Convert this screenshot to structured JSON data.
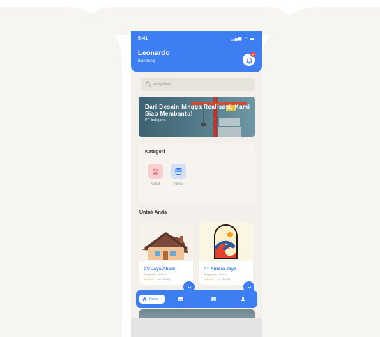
{
  "status": {
    "time": "9:41",
    "icons": "▂▄▆ ◠ ▬"
  },
  "header": {
    "name": "Leonardo",
    "city": "Bandung",
    "notif_count": "9+"
  },
  "search": {
    "placeholder": "cari jobmu"
  },
  "banner": {
    "title": "Dari Desain hingga Realisasi, Kami Siap Membantu!",
    "subtitle": "PT Indojaya"
  },
  "categories": {
    "title": "Kategori",
    "items": [
      {
        "label": "Rumah",
        "icon": "house-icon",
        "color": "#f8cfd0"
      },
      {
        "label": "Interior",
        "icon": "interior-icon",
        "color": "#d5dff5"
      }
    ]
  },
  "section": {
    "title": "Untuk Anda"
  },
  "cards": [
    {
      "name": "CV Jaya Abadi",
      "category": "Bangunan / Interior",
      "stars": "★★★★☆",
      "rating": "4.8 (2.440)"
    },
    {
      "name": "PT Amora Jaya",
      "category": "Bangunan / Interior",
      "stars": "★★★★☆",
      "rating": "4.9 (3.960)"
    }
  ],
  "nav": {
    "home_label": "Home",
    "items": [
      "home-icon",
      "chart-icon",
      "inbox-icon",
      "profile-icon"
    ]
  },
  "colors": {
    "primary": "#3d7ef2",
    "background": "#f3efea"
  }
}
